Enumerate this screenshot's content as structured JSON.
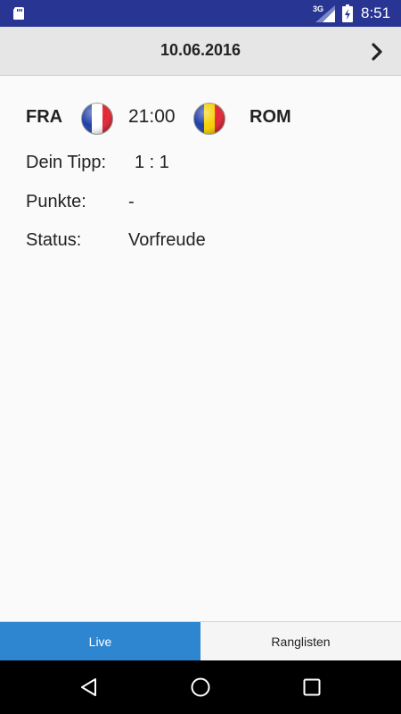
{
  "status_bar": {
    "network": "3G",
    "time": "8:51",
    "icons": [
      "sd-card-icon",
      "signal-icon",
      "battery-charging-icon"
    ]
  },
  "header": {
    "date": "10.06.2016",
    "next_icon": "chevron-right-icon"
  },
  "match": {
    "home_team": "FRA",
    "away_team": "ROM",
    "kickoff": "21:00",
    "home_flag": {
      "icon": "flag-france-icon",
      "colors": [
        "#1f3fa6",
        "#ffffff",
        "#e32636"
      ]
    },
    "away_flag": {
      "icon": "flag-romania-icon",
      "colors": [
        "#1f3fa6",
        "#f5d000",
        "#e32636"
      ]
    }
  },
  "details": {
    "tip_label": "Dein Tipp:",
    "tip_value": "1 : 1",
    "points_label": "Punkte:",
    "points_value": "-",
    "status_label": "Status:",
    "status_value": "Vorfreude"
  },
  "tabs": [
    {
      "label": "Live",
      "active": true
    },
    {
      "label": "Ranglisten",
      "active": false
    }
  ],
  "nav": {
    "icons": [
      "back-icon",
      "home-icon",
      "recents-icon"
    ]
  },
  "colors": {
    "status_bar": "#283593",
    "active_tab": "#2e86d1",
    "header_bg": "#e6e6e6"
  }
}
